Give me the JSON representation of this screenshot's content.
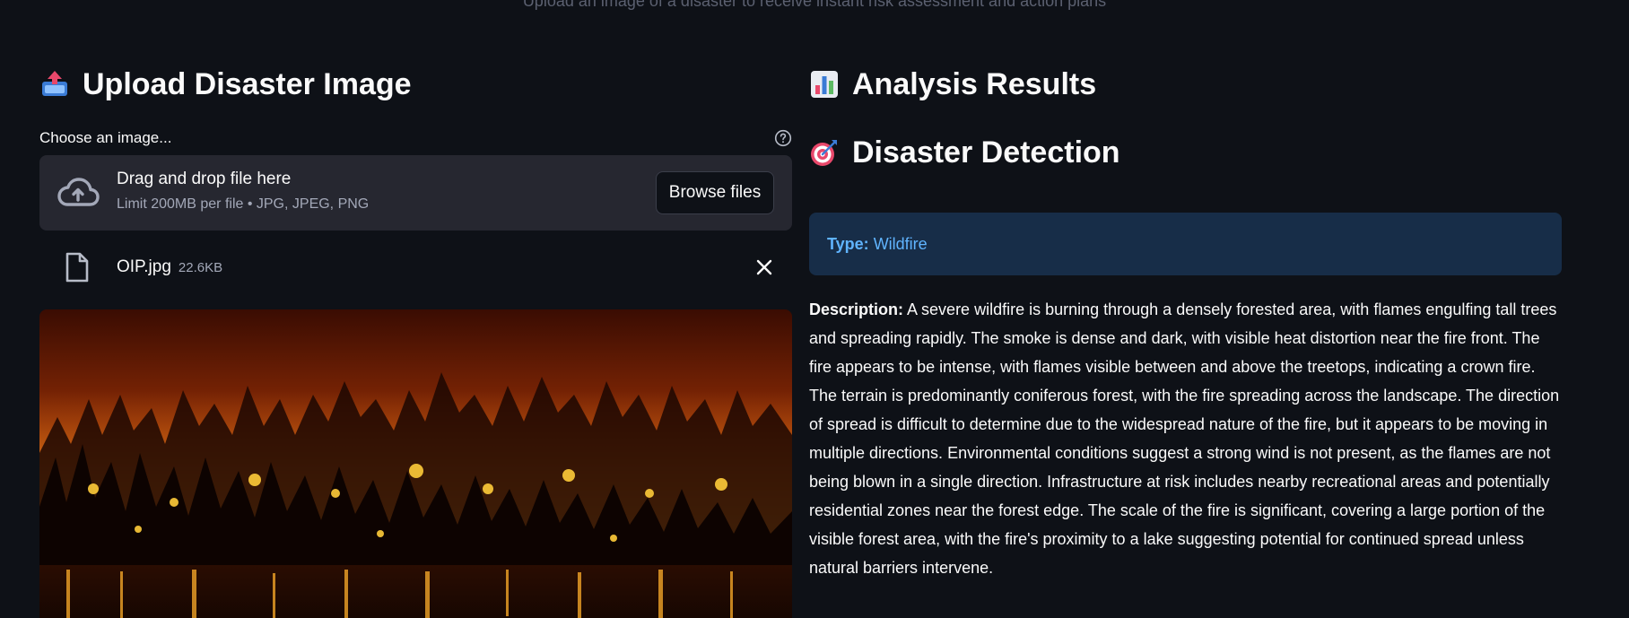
{
  "header": {
    "subtitle": "Upload an image of a disaster to receive instant risk assessment and action plans"
  },
  "upload": {
    "title": "Upload Disaster Image",
    "title_icon": "inbox-tray-icon",
    "file_label": "Choose an image...",
    "dropzone_title": "Drag and drop file here",
    "dropzone_limit": "Limit 200MB per file • JPG, JPEG, PNG",
    "browse_label": "Browse files",
    "file": {
      "name": "OIP.jpg",
      "size": "22.6KB"
    }
  },
  "results": {
    "title": "Analysis Results",
    "title_icon": "bar-chart-icon",
    "detection_title": "Disaster Detection",
    "detection_icon": "direct-hit-icon",
    "type_label": "Type:",
    "type_value": "Wildfire",
    "description_label": "Description:",
    "description_text": "A severe wildfire is burning through a densely forested area, with flames engulfing tall trees and spreading rapidly. The smoke is dense and dark, with visible heat distortion near the fire front. The fire appears to be intense, with flames visible between and above the treetops, indicating a crown fire. The terrain is predominantly coniferous forest, with the fire spreading across the landscape. The direction of spread is difficult to determine due to the widespread nature of the fire, but it appears to be moving in multiple directions. Environmental conditions suggest a strong wind is not present, as the flames are not being blown in a single direction. Infrastructure at risk includes nearby recreational areas and potentially residential zones near the forest edge. The scale of the fire is significant, covering a large portion of the visible forest area, with the fire's proximity to a lake suggesting potential for continued spread unless natural barriers intervene."
  },
  "colors": {
    "background": "#0e1117",
    "panel": "#262730",
    "info_box": "#172d48",
    "info_text": "#60b4ff"
  }
}
